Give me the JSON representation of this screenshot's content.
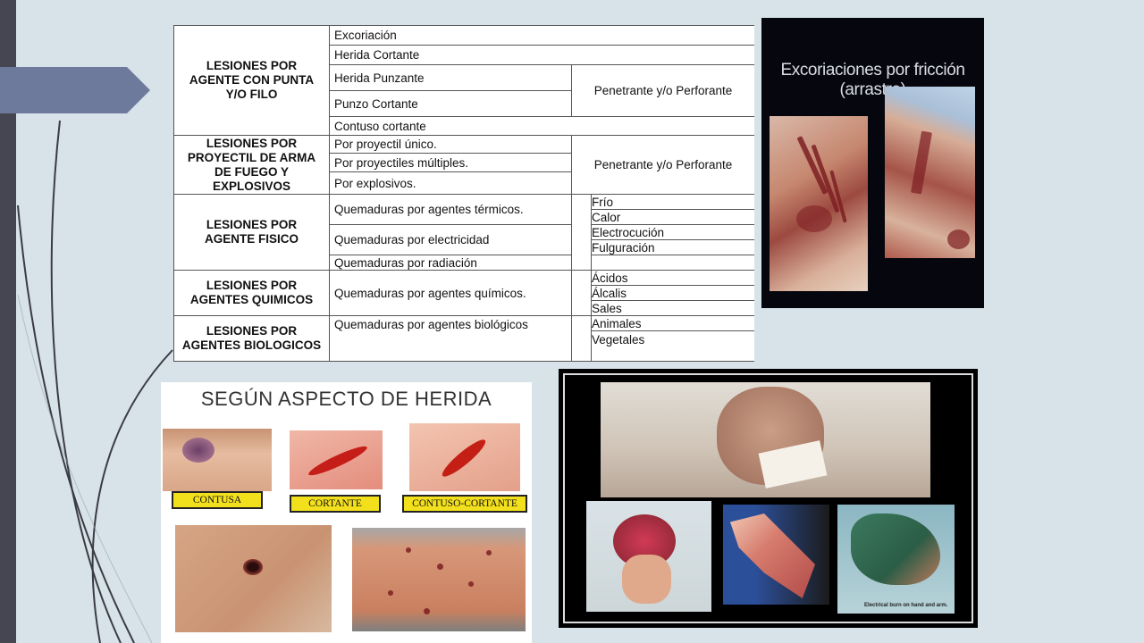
{
  "table": {
    "rows": [
      {
        "cat": "LESIONES POR AGENTE CON PUNTA Y/O FILO",
        "items": [
          "Excoriación",
          "Herida Cortante",
          "Herida Punzante",
          "Punzo Cortante",
          "Contuso cortante"
        ],
        "note": "Penetrante y/o Perforante"
      },
      {
        "cat": "LESIONES POR PROYECTIL DE ARMA DE FUEGO Y EXPLOSIVOS",
        "items": [
          "Por proyectil único.",
          "Por proyectiles múltiples.",
          "Por explosivos."
        ],
        "note": "Penetrante y/o Perforante"
      },
      {
        "cat": "LESIONES POR AGENTE FISICO",
        "items": [
          "Quemaduras por agentes térmicos.",
          "Quemaduras por electricidad",
          "Quemaduras por radiación"
        ],
        "subs": [
          "Frío",
          "Calor",
          "Electrocución",
          "Fulguración"
        ]
      },
      {
        "cat": "LESIONES POR AGENTES QUIMICOS",
        "items": [
          "Quemaduras por agentes químicos."
        ],
        "subs": [
          "Ácidos",
          "Álcalis",
          "Sales"
        ]
      },
      {
        "cat": "LESIONES POR AGENTES BIOLOGICOS",
        "items": [
          "Quemaduras por agentes biológicos"
        ],
        "subs": [
          "Animales",
          "Vegetales"
        ]
      }
    ]
  },
  "excoriation_photo": {
    "title": "Excoriaciones por fricción (arrastre)"
  },
  "wound_photo": {
    "title": "SEGÚN ASPECTO DE HERIDA",
    "labels": [
      "CONTUSA",
      "CORTANTE",
      "CONTUSO-CORTANTE"
    ]
  },
  "burn_photo": {
    "caption": "Electrical burn on hand and arm."
  },
  "colors": {
    "background": "#d7e3e8",
    "sidebar": "#464652",
    "arrow": "#6e7a9c",
    "label_yellow": "#f3e01d"
  }
}
